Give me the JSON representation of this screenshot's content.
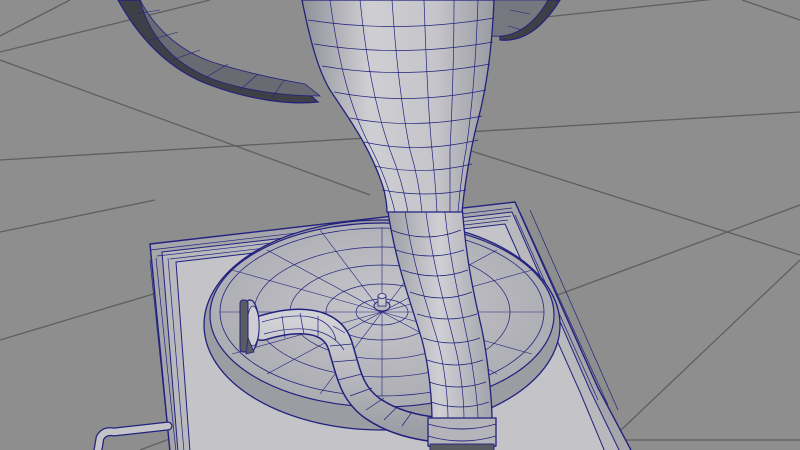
{
  "viewport": {
    "background": "#8e8e8e",
    "grid_color": "#5f5f5f",
    "wire_color": "#22227e",
    "surface_light": "#c9c9cc",
    "surface_mid": "#a7a7ad",
    "surface_dark": "#5b5b63"
  }
}
